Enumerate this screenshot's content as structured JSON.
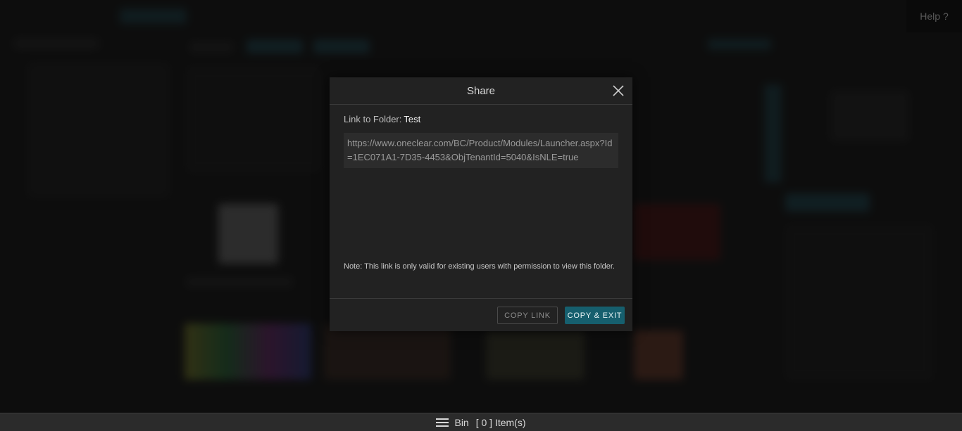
{
  "header": {
    "help_label": "Help ?"
  },
  "modal": {
    "title": "Share",
    "folder_label": "Link to Folder:",
    "folder_name": "Test",
    "link_url": "https://www.oneclear.com/BC/Product/Modules/Launcher.aspx?Id=1EC071A1-7D35-4453&ObjTenantId=5040&IsNLE=true",
    "note": "Note: This link is only valid for existing users with permission to view this folder.",
    "copy_link_label": "COPY LINK",
    "copy_exit_label": "COPY & EXIT"
  },
  "bin_bar": {
    "label": "Bin",
    "count_text": "[ 0 ] Item(s)"
  },
  "colors": {
    "accent": "#165f6e",
    "modal_bg": "#222222",
    "backdrop": "#151515"
  },
  "icons": {
    "close": "close-icon",
    "menu": "hamburger-menu-icon"
  }
}
